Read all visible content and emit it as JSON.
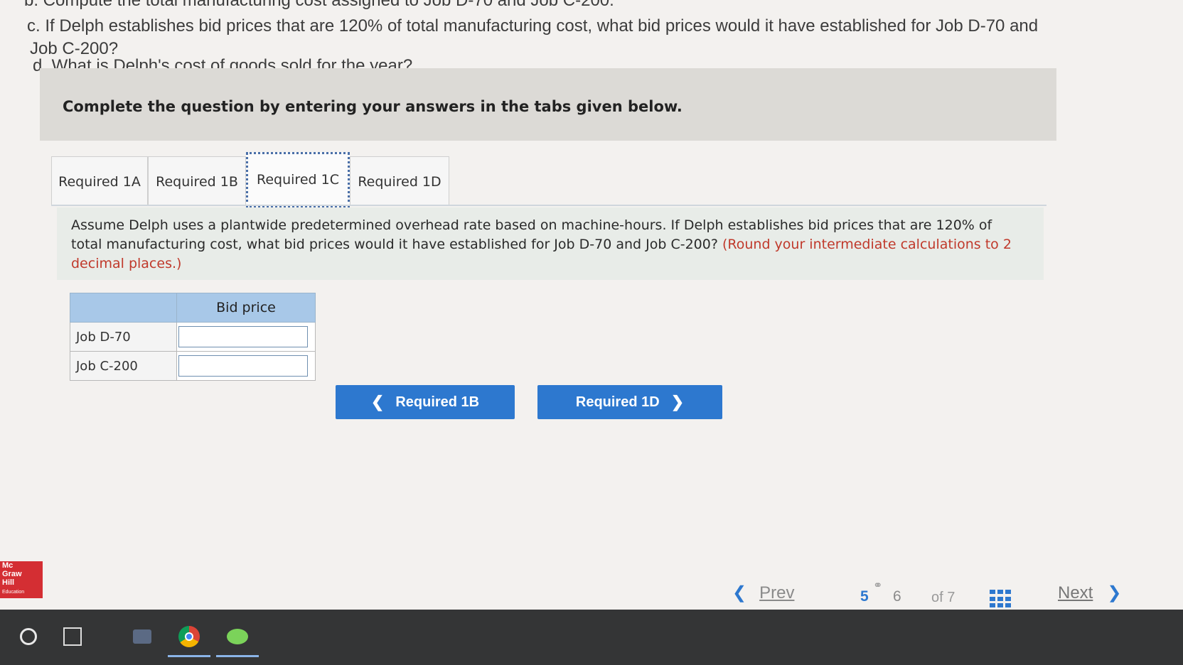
{
  "question": {
    "line_b": "b. Compute the total manufacturing cost assigned to Job D-70 and Job C-200.",
    "line_c": "c. If Delph establishes bid prices that are 120% of total manufacturing cost, what bid prices would it have established for Job D-70 and",
    "line_c2": "Job C-200?",
    "line_d": "d. What is Delph's cost of goods sold for the year?"
  },
  "instruction": "Complete the question by entering your answers in the tabs given below.",
  "tabs": [
    {
      "label": "Required 1A"
    },
    {
      "label": "Required 1B"
    },
    {
      "label": "Required 1C"
    },
    {
      "label": "Required 1D"
    }
  ],
  "active_tab": "Required 1C",
  "panel": {
    "text": "Assume Delph uses a plantwide predetermined overhead rate based on machine-hours. If Delph establishes bid prices that are 120% of total manufacturing cost, what bid prices would it have established for Job D-70 and Job C-200?",
    "hint": "(Round your intermediate calculations to 2 decimal places.)"
  },
  "table": {
    "header": "Bid price",
    "rows": [
      {
        "label": "Job D-70",
        "value": ""
      },
      {
        "label": "Job C-200",
        "value": ""
      }
    ]
  },
  "nav": {
    "prev_label": "Required 1B",
    "next_label": "Required 1D"
  },
  "logo": {
    "line1": "Mc",
    "line2": "Graw",
    "line3": "Hill",
    "line4": "Education"
  },
  "pager": {
    "prev_label": "Prev",
    "current_page": "5",
    "next_page": "6",
    "of_total": "of 7",
    "next_label": "Next"
  },
  "colors": {
    "accent": "#2d78cf",
    "hint": "#c0392b",
    "table_header": "#a8c8e8"
  }
}
